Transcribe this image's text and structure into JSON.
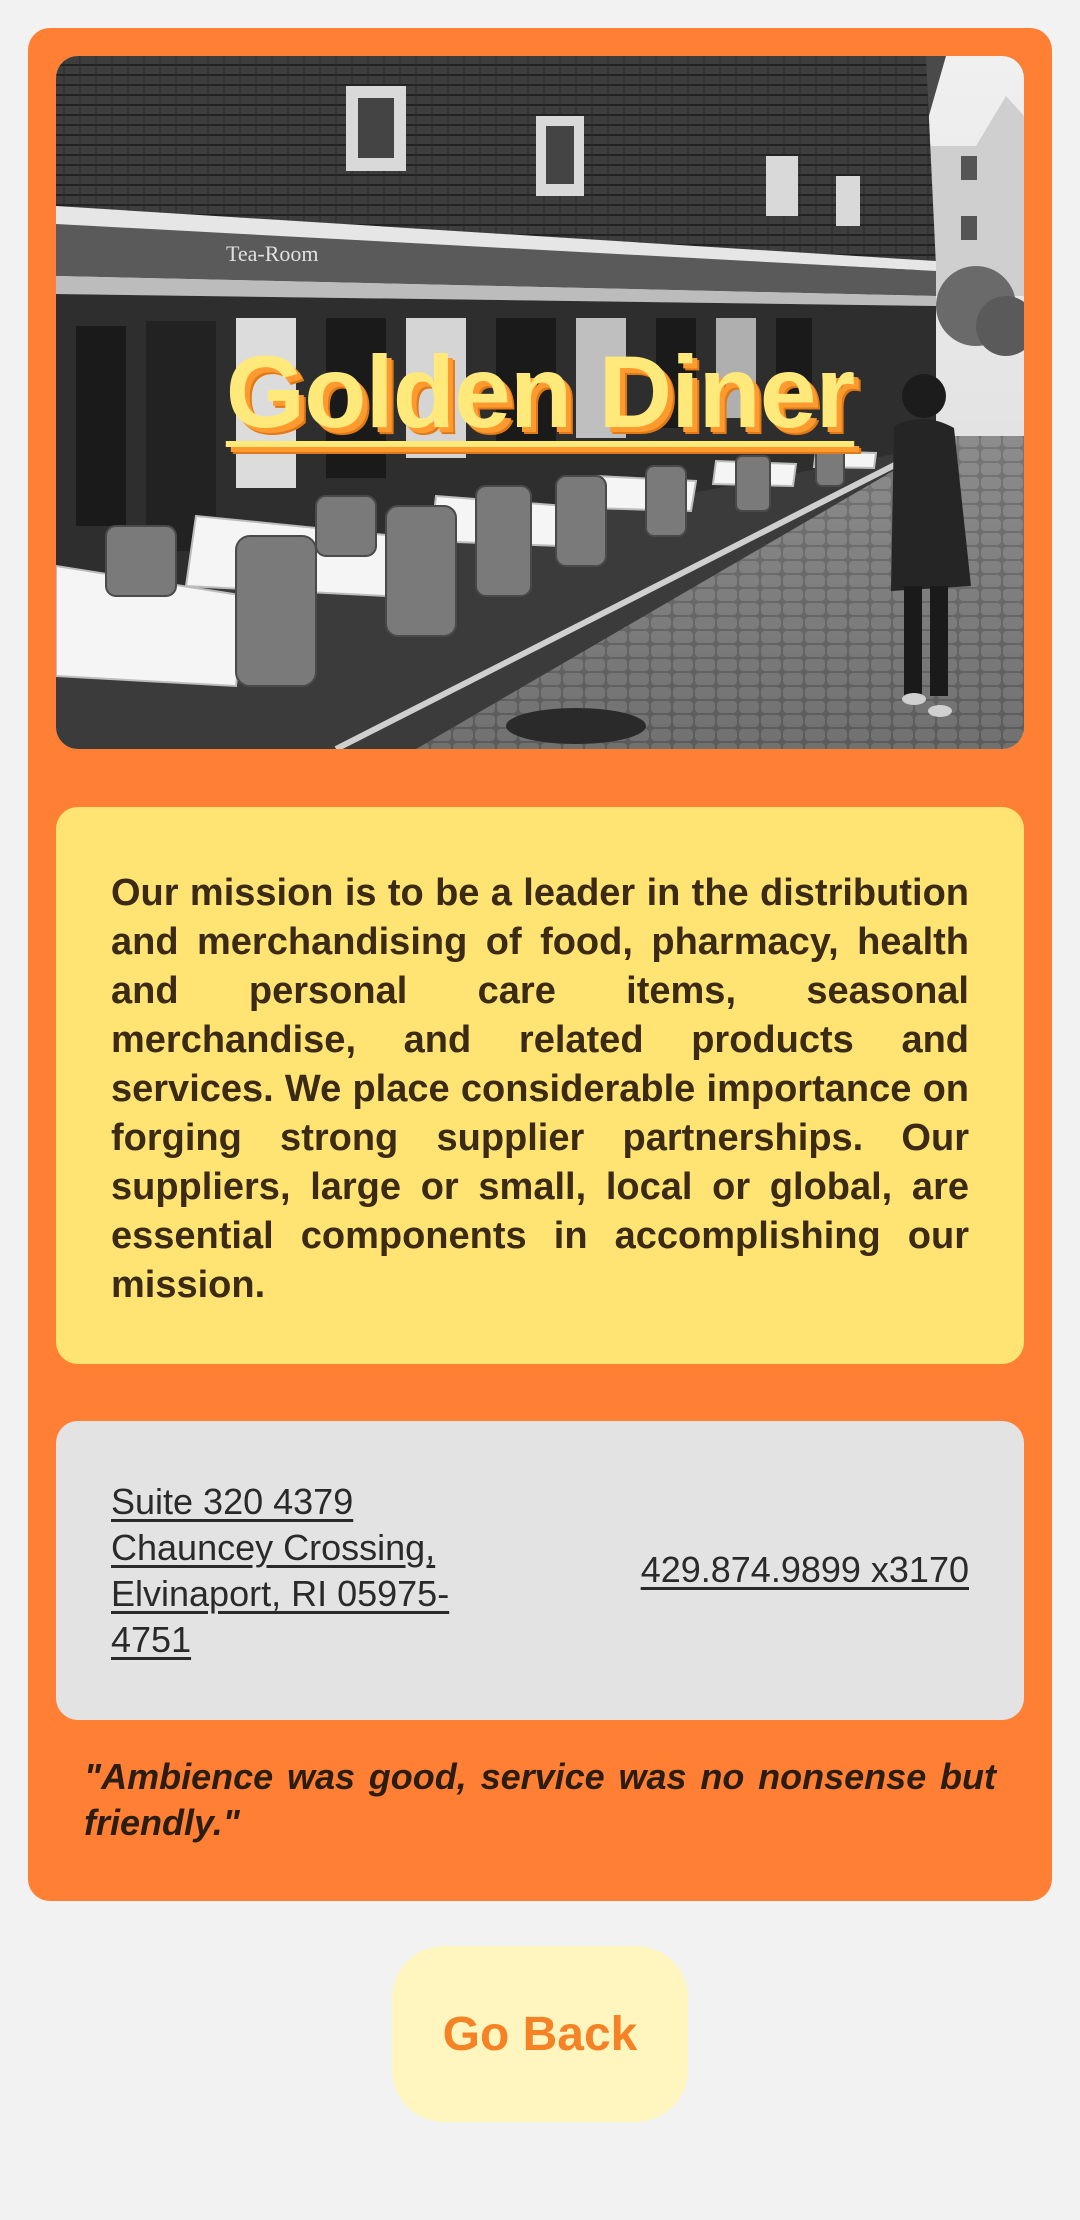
{
  "hero": {
    "title": "Golden Diner",
    "sign_text": "Tea-Room"
  },
  "mission": {
    "text": "Our mission is to be a leader in the distribution and merchandising of food, pharmacy, health and personal care items, seasonal merchandise, and related products and services. We place considerable importance on forging strong supplier partnerships. Our suppliers, large or small, local or global, are essential components in accomplishing our mission."
  },
  "contact": {
    "address": "Suite 320 4379 Chauncey Crossing, Elvinaport, RI 05975-4751",
    "phone": "429.874.9899 x3170"
  },
  "review": {
    "text": "\"Ambience was good, service was no nonsense but friendly.\""
  },
  "actions": {
    "go_back_label": "Go Back"
  },
  "colors": {
    "page_background": "#f2f2f2",
    "card_background": "#ff7f35",
    "mission_background": "#ffe474",
    "contact_background": "#e3e3e3",
    "title_color": "#ffe97a",
    "button_background": "#fff6bf",
    "button_text": "#f58225"
  }
}
